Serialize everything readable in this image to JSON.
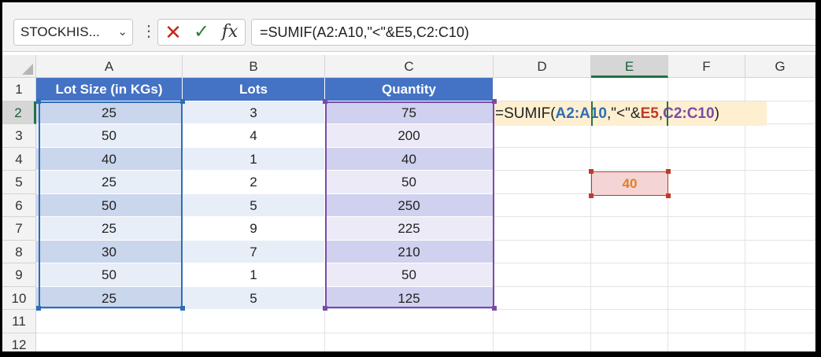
{
  "name_box": {
    "value": "STOCKHIS...",
    "chevron_icon": "chevron-down-icon"
  },
  "formula_bar": {
    "more_icon": "vertical-ellipsis-icon",
    "cancel_icon": "close-icon",
    "enter_icon": "checkmark-icon",
    "fx_label": "fx",
    "formula": "=SUMIF(A2:A10,\"<\"&E5,C2:C10)"
  },
  "columns": [
    "A",
    "B",
    "C",
    "D",
    "E",
    "F",
    "G"
  ],
  "rows": [
    "1",
    "2",
    "3",
    "4",
    "5",
    "6",
    "7",
    "8",
    "9",
    "10",
    "11",
    "12"
  ],
  "table": {
    "headers": [
      "Lot Size (in KGs)",
      "Lots",
      "Quantity"
    ],
    "data": [
      [
        "25",
        "3",
        "75"
      ],
      [
        "50",
        "4",
        "200"
      ],
      [
        "40",
        "1",
        "40"
      ],
      [
        "25",
        "2",
        "50"
      ],
      [
        "50",
        "5",
        "250"
      ],
      [
        "25",
        "9",
        "225"
      ],
      [
        "30",
        "7",
        "210"
      ],
      [
        "50",
        "1",
        "50"
      ],
      [
        "25",
        "5",
        "125"
      ]
    ]
  },
  "edit_formula": {
    "prefix": "=SUMIF(",
    "ref_a": "A2:A10",
    "sep1": ",\"<\"&",
    "ref_e": "E5",
    "sep2": ",",
    "ref_c": "C2:C10",
    "suffix": ")"
  },
  "e5_value": "40",
  "colors": {
    "header_fill": "#4472c4",
    "ref_a": "#2f6db5",
    "ref_e": "#c0392b",
    "ref_c": "#7b4ba6",
    "selection": "#217346"
  }
}
